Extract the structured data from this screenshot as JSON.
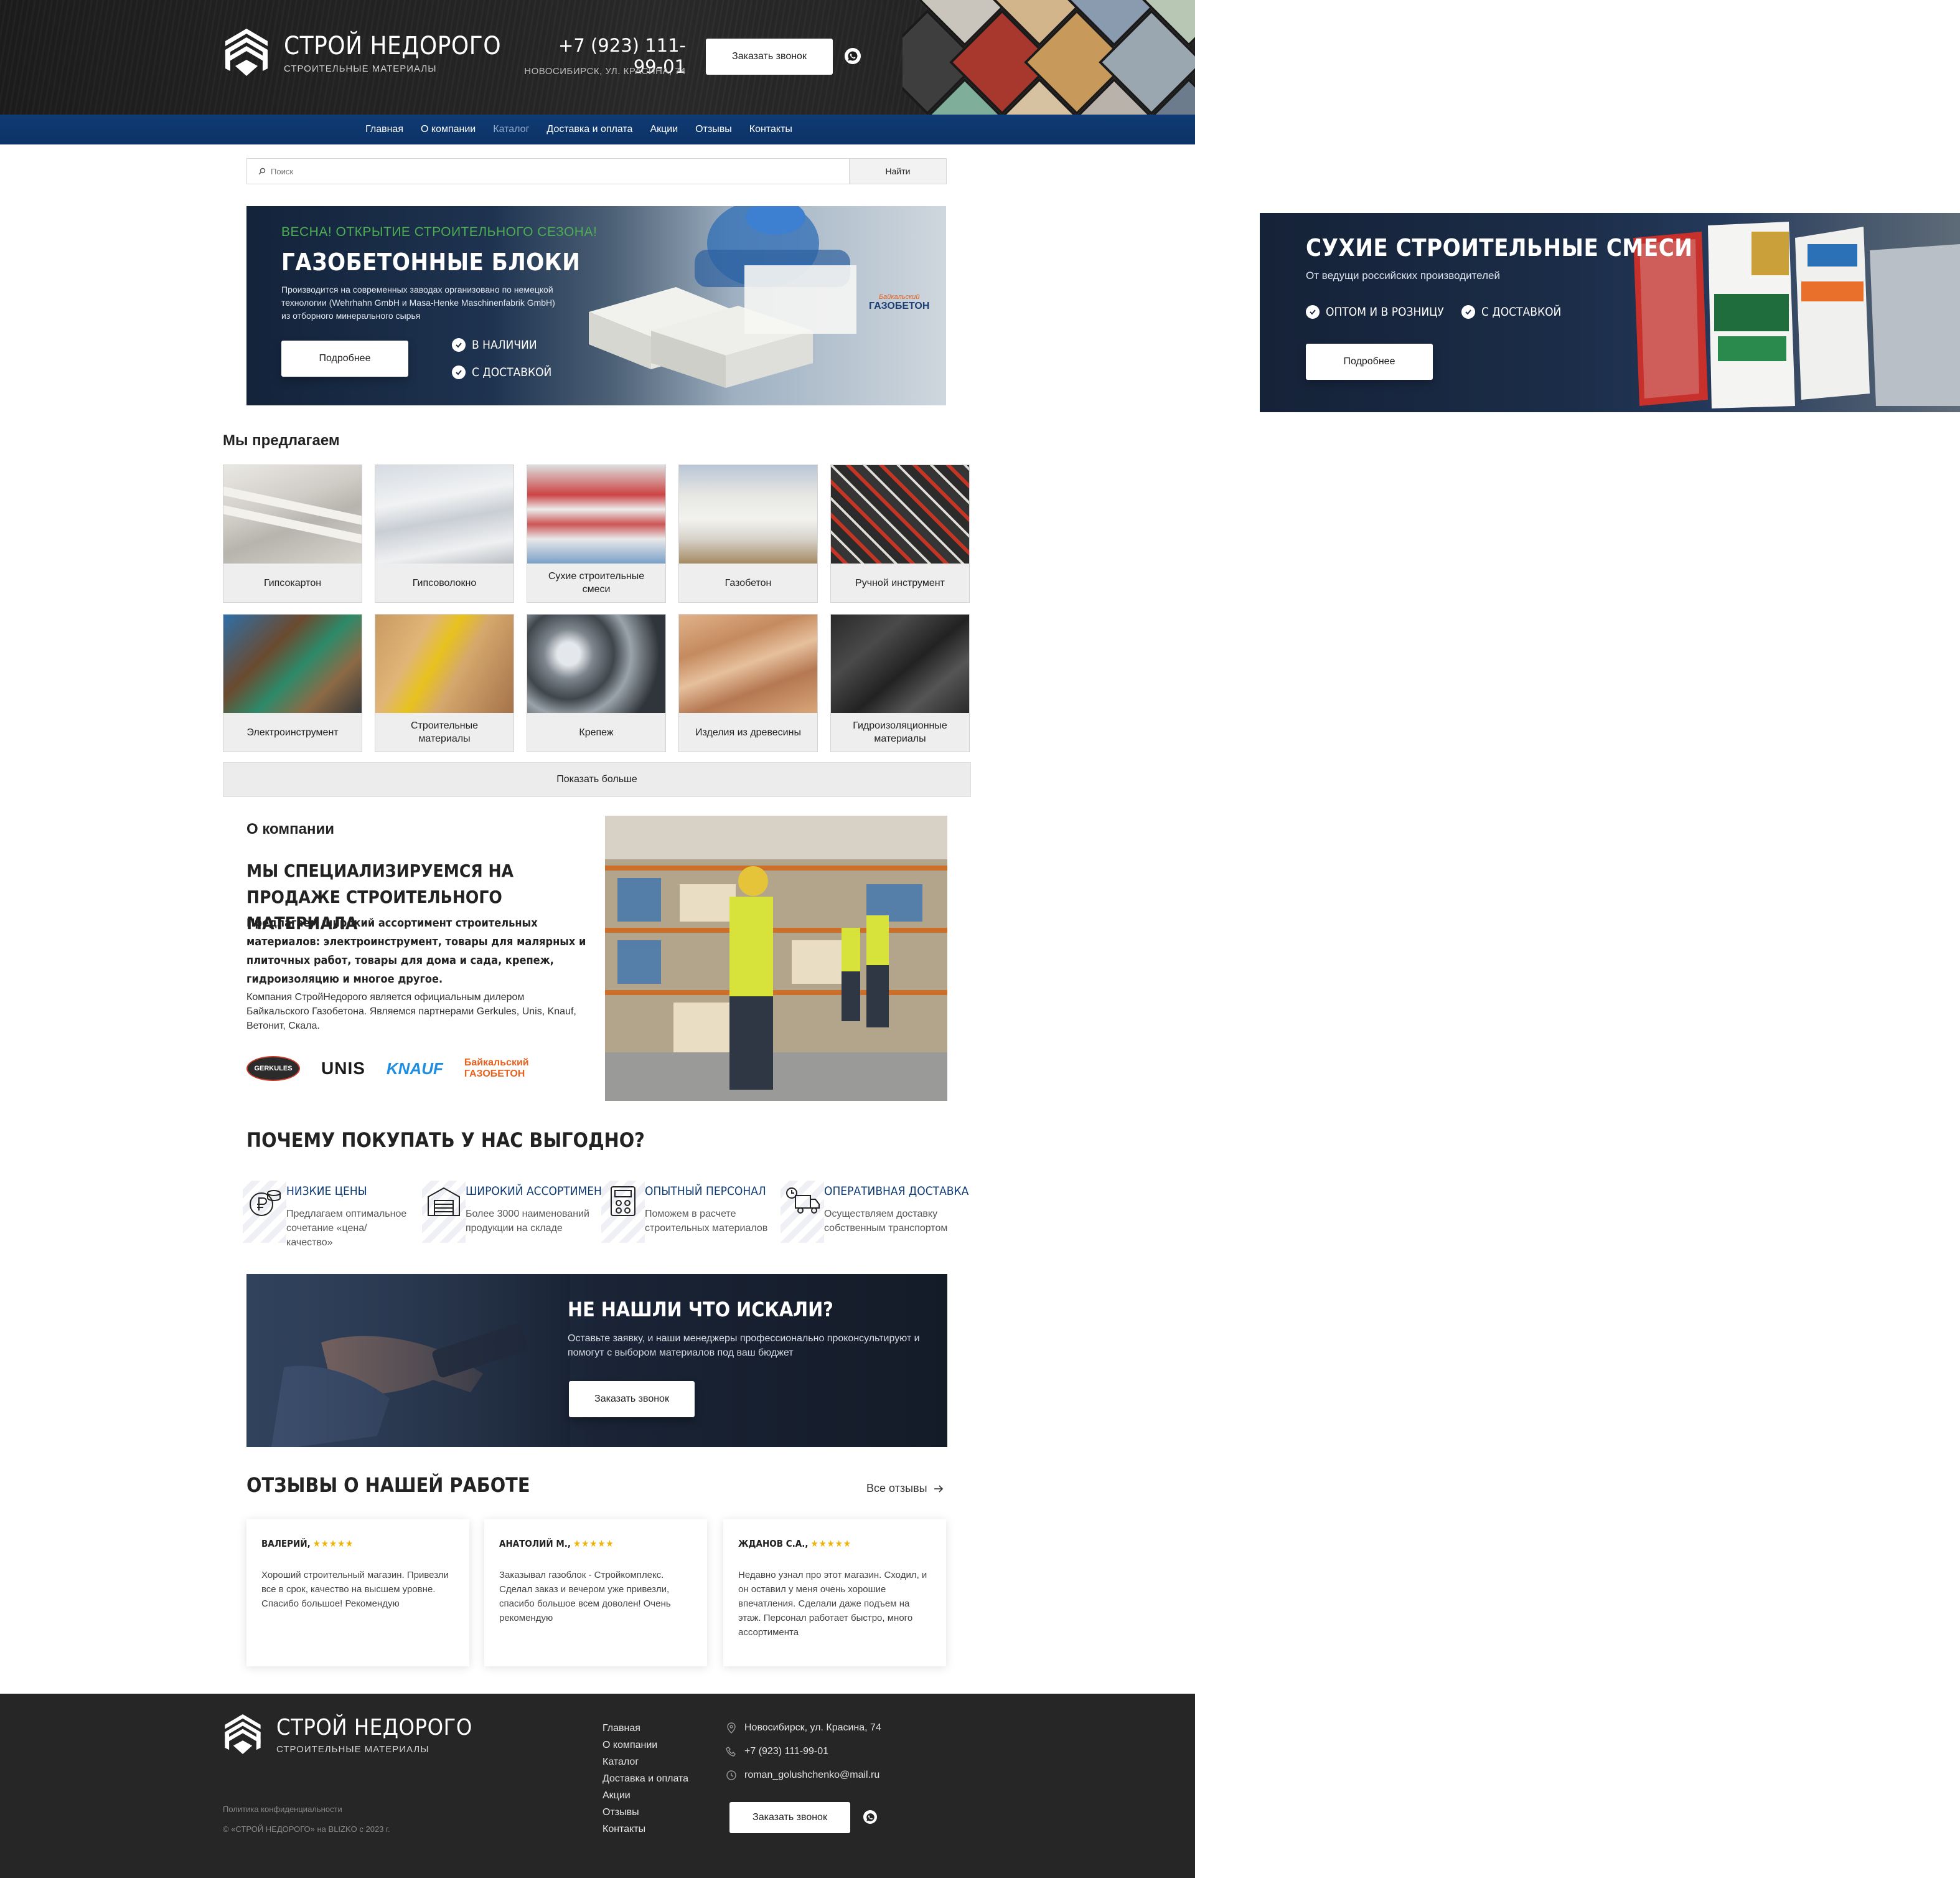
{
  "header": {
    "brand_title": "СТРОЙ НЕДОРОГО",
    "brand_subtitle": "СТРОИТЕЛЬНЫЕ МАТЕРИАЛЫ",
    "phone": "+7 (923) 111-99-01",
    "address": "НОВОСИБИРСК, УЛ. КРАСИНА, 74",
    "call_button": "Заказать звонок"
  },
  "nav": {
    "items": [
      "Главная",
      "О компании",
      "Каталог",
      "Доставка и оплата",
      "Акции",
      "Отзывы",
      "Контакты"
    ],
    "active": "Каталог"
  },
  "search": {
    "placeholder": "Поиск",
    "button": "Найти"
  },
  "hero_main": {
    "kicker": "ВЕСНА! ОТКРЫТИЕ СТРОИТЕЛЬНОГО СЕЗОНА!",
    "title": "ГАЗОБЕТОННЫЕ БЛОКИ",
    "description": "Производится на современных заводах организовано по немецкой технологии (Wehrhahn GmbH и Masa-Henke Maschinenfabrik GmbH) из отборного минерального сырья",
    "button": "Подробнее",
    "check1": "В НАЛИЧИИ",
    "check2": "С ДОСТАВКОЙ",
    "block_logo_top": "Байкальский",
    "block_logo_main": "ГАЗОБЕТОН"
  },
  "hero_side": {
    "title": "СУХИЕ СТРОИТЕЛЬНЫЕ СМЕСИ",
    "description": "От ведущи российских производителей",
    "check1": "ОПТОМ И В РОЗНИЦУ",
    "check2": "С ДОСТАВКОЙ",
    "button": "Подробнее"
  },
  "offer": {
    "title": "Мы предлагаем",
    "items": [
      {
        "label": "Гипсокартон",
        "icon": "drywall-image"
      },
      {
        "label": "Гипсоволокно",
        "icon": "gypsum-fiber-image"
      },
      {
        "label": "Сухие строительные смеси",
        "icon": "dry-mix-image"
      },
      {
        "label": "Газобетон",
        "icon": "aerated-concrete-image"
      },
      {
        "label": "Ручной инструмент",
        "icon": "hand-tools-image"
      },
      {
        "label": "Электроинструмент",
        "icon": "power-tools-image"
      },
      {
        "label": "Строительные материалы",
        "icon": "building-materials-image"
      },
      {
        "label": "Крепеж",
        "icon": "fasteners-image"
      },
      {
        "label": "Изделия из древесины",
        "icon": "wood-products-image"
      },
      {
        "label": "Гидроизоляционные материалы",
        "icon": "waterproofing-image"
      }
    ],
    "more_button": "Показать больше"
  },
  "about": {
    "section_title": "О компании",
    "title": "МЫ СПЕЦИАЛИЗИРУЕМСЯ НА ПРОДАЖЕ СТРОИТЕЛЬНОГО МАТЕРИАЛА",
    "lead": "Предлагаем широкий ассортимент строительных материалов: электроинструмент, товары для малярных и плиточных работ, товары для дома и сада, крепеж, гидроизоляцию и многое другое.",
    "text": "Компания СтройНедорого является официальным дилером Байкальского Газобетона.  Являемся партнерами Gerkules, Unis, Knauf, Ветонит, Скала.",
    "partners": [
      "GERKULES",
      "UNIS",
      "KNAUF",
      "Байкальский ГАЗОБЕТОН"
    ]
  },
  "why": {
    "title": "ПОЧЕМУ ПОКУПАТЬ У НАС ВЫГОДНО?",
    "features": [
      {
        "title": "НИЗКИЕ ЦЕНЫ",
        "text": "Предлагаем оптимальное сочетание «цена/качество»",
        "icon": "coins-icon"
      },
      {
        "title": "ШИРОКИЙ АССОРТИМЕНТ",
        "text": "Более 3000 наименований продукции на складе",
        "icon": "warehouse-icon"
      },
      {
        "title": "ОПЫТНЫЙ ПЕРСОНАЛ",
        "text": "Поможем в расчете строительных материалов",
        "icon": "calculator-icon"
      },
      {
        "title": "ОПЕРАТИВНАЯ ДОСТАВКА",
        "text": "Осуществляем доставку собственным транспортом",
        "icon": "delivery-truck-icon"
      }
    ]
  },
  "cta": {
    "title": "НЕ НАШЛИ ЧТО ИСКАЛИ?",
    "text": "Оставьте заявку, и наши менеджеры профессионально проконсультируют и помогут с выбором материалов под ваш бюджет",
    "button": "Заказать звонок"
  },
  "reviews": {
    "title": "ОТЗЫВЫ О НАШЕЙ РАБОТЕ",
    "all_link": "Все отзывы",
    "items": [
      {
        "name": "ВАЛЕРИЙ,",
        "stars": "★★★★★",
        "text": "Хороший строительный магазин. Привезли все в срок, качество на высшем уровне. Спасибо большое! Рекомендую"
      },
      {
        "name": "АНАТОЛИЙ М.,",
        "stars": "★★★★★",
        "text": "Заказывал газоблок - Стройкомплекс. Сделал заказ и вечером уже привезли, спасибо большое всем доволен! Очень рекомендую"
      },
      {
        "name": "ЖДАНОВ С.А.,",
        "stars": "★★★★★",
        "text": "Недавно узнал про этот магазин. Сходил, и он оставил у меня очень хорошие впечатления. Сделали даже подъем на этаж. Персонал работает быстро, много ассортимента"
      }
    ]
  },
  "footer": {
    "brand_title": "СТРОЙ НЕДОРОГО",
    "brand_subtitle": "СТРОИТЕЛЬНЫЕ МАТЕРИАЛЫ",
    "policy": "Политика конфиденциальности",
    "copyright": "© «СТРОЙ НЕДОРОГО» на BLIZKO с 2023 г.",
    "nav": [
      "Главная",
      "О компании",
      "Каталог",
      "Доставка и оплата",
      "Акции",
      "Отзывы",
      "Контакты"
    ],
    "address": "Новосибирск, ул. Красина, 74",
    "phone": "+7 (923) 111-99-01",
    "email": "roman_golushchenko@mail.ru",
    "call_button": "Заказать звонок"
  },
  "colors": {
    "nav_blue": "#0f3a73",
    "accent_green": "#4caf50",
    "feature_blue": "#0e3a73",
    "star_gold": "#f0b400",
    "footer_dark": "#262626"
  }
}
